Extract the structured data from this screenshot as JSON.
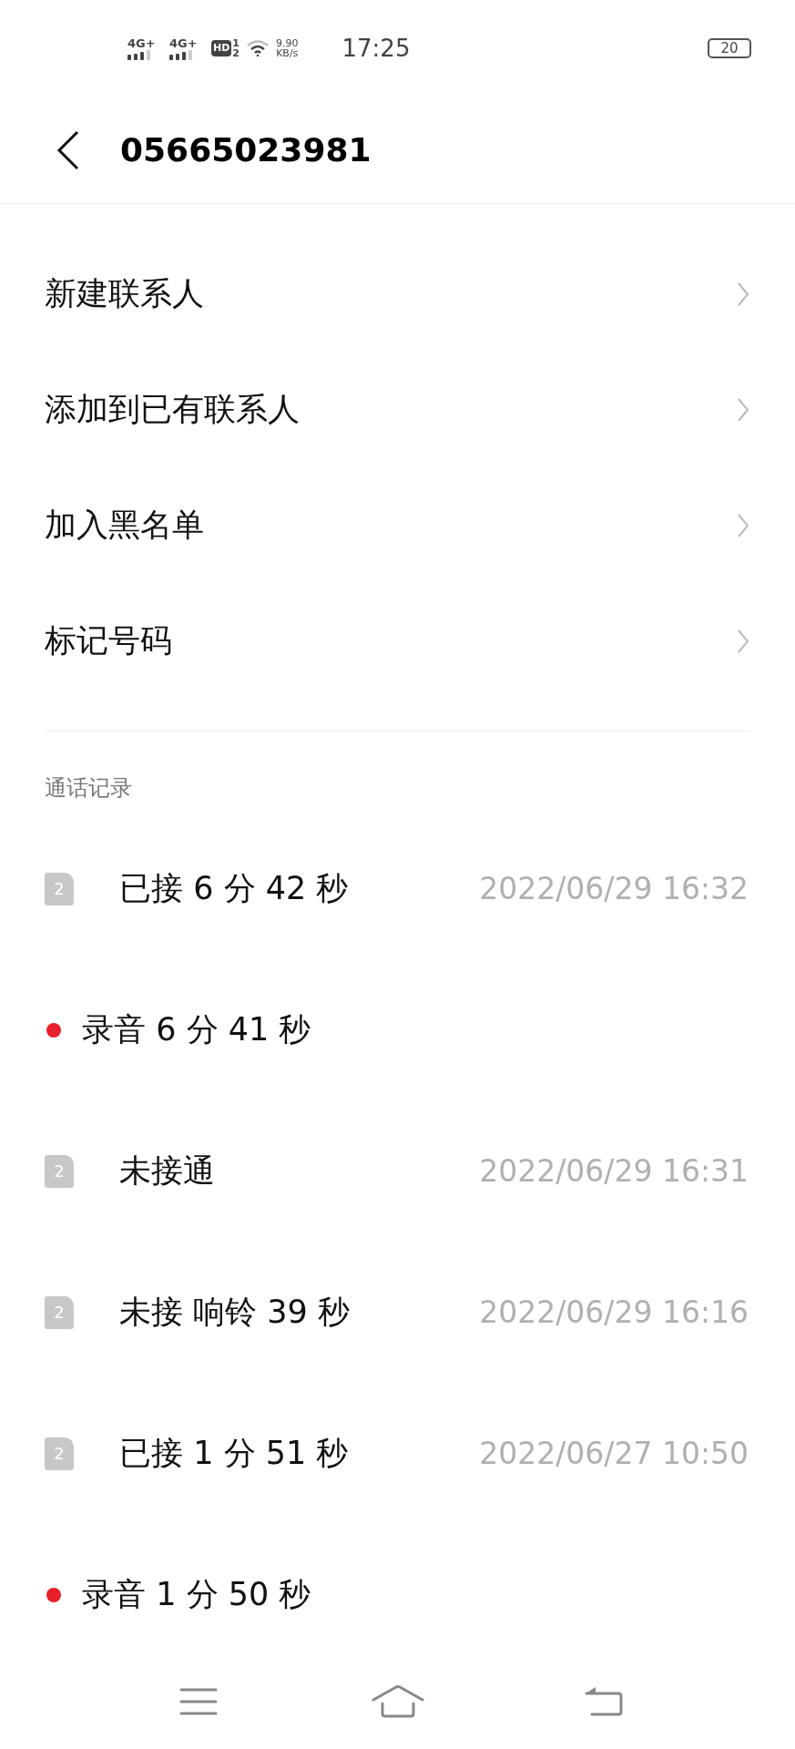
{
  "status_bar": {
    "signals": [
      {
        "label": "4G+"
      },
      {
        "label": "4G+"
      }
    ],
    "hd": {
      "label": "HD",
      "sim_1": "1",
      "sim_2": "2"
    },
    "speed_value": "9.90",
    "speed_unit": "KB/s",
    "time": "17:25",
    "battery": "20"
  },
  "header": {
    "title": "05665023981"
  },
  "menu": [
    {
      "label": "新建联系人"
    },
    {
      "label": "添加到已有联系人"
    },
    {
      "label": "加入黑名单"
    },
    {
      "label": "标记号码"
    }
  ],
  "section_title": "通话记录",
  "records": [
    {
      "kind": "call",
      "sim": "2",
      "text": "已接 6 分 42 秒",
      "time": "2022/06/29 16:32"
    },
    {
      "kind": "recording",
      "text": "录音 6 分 41 秒"
    },
    {
      "kind": "call",
      "sim": "2",
      "text": "未接通",
      "time": "2022/06/29 16:31"
    },
    {
      "kind": "call",
      "sim": "2",
      "text": "未接 响铃 39 秒",
      "time": "2022/06/29 16:16"
    },
    {
      "kind": "call",
      "sim": "2",
      "text": "已接 1 分 51 秒",
      "time": "2022/06/27 10:50"
    },
    {
      "kind": "recording",
      "text": "录音 1 分 50 秒"
    }
  ]
}
